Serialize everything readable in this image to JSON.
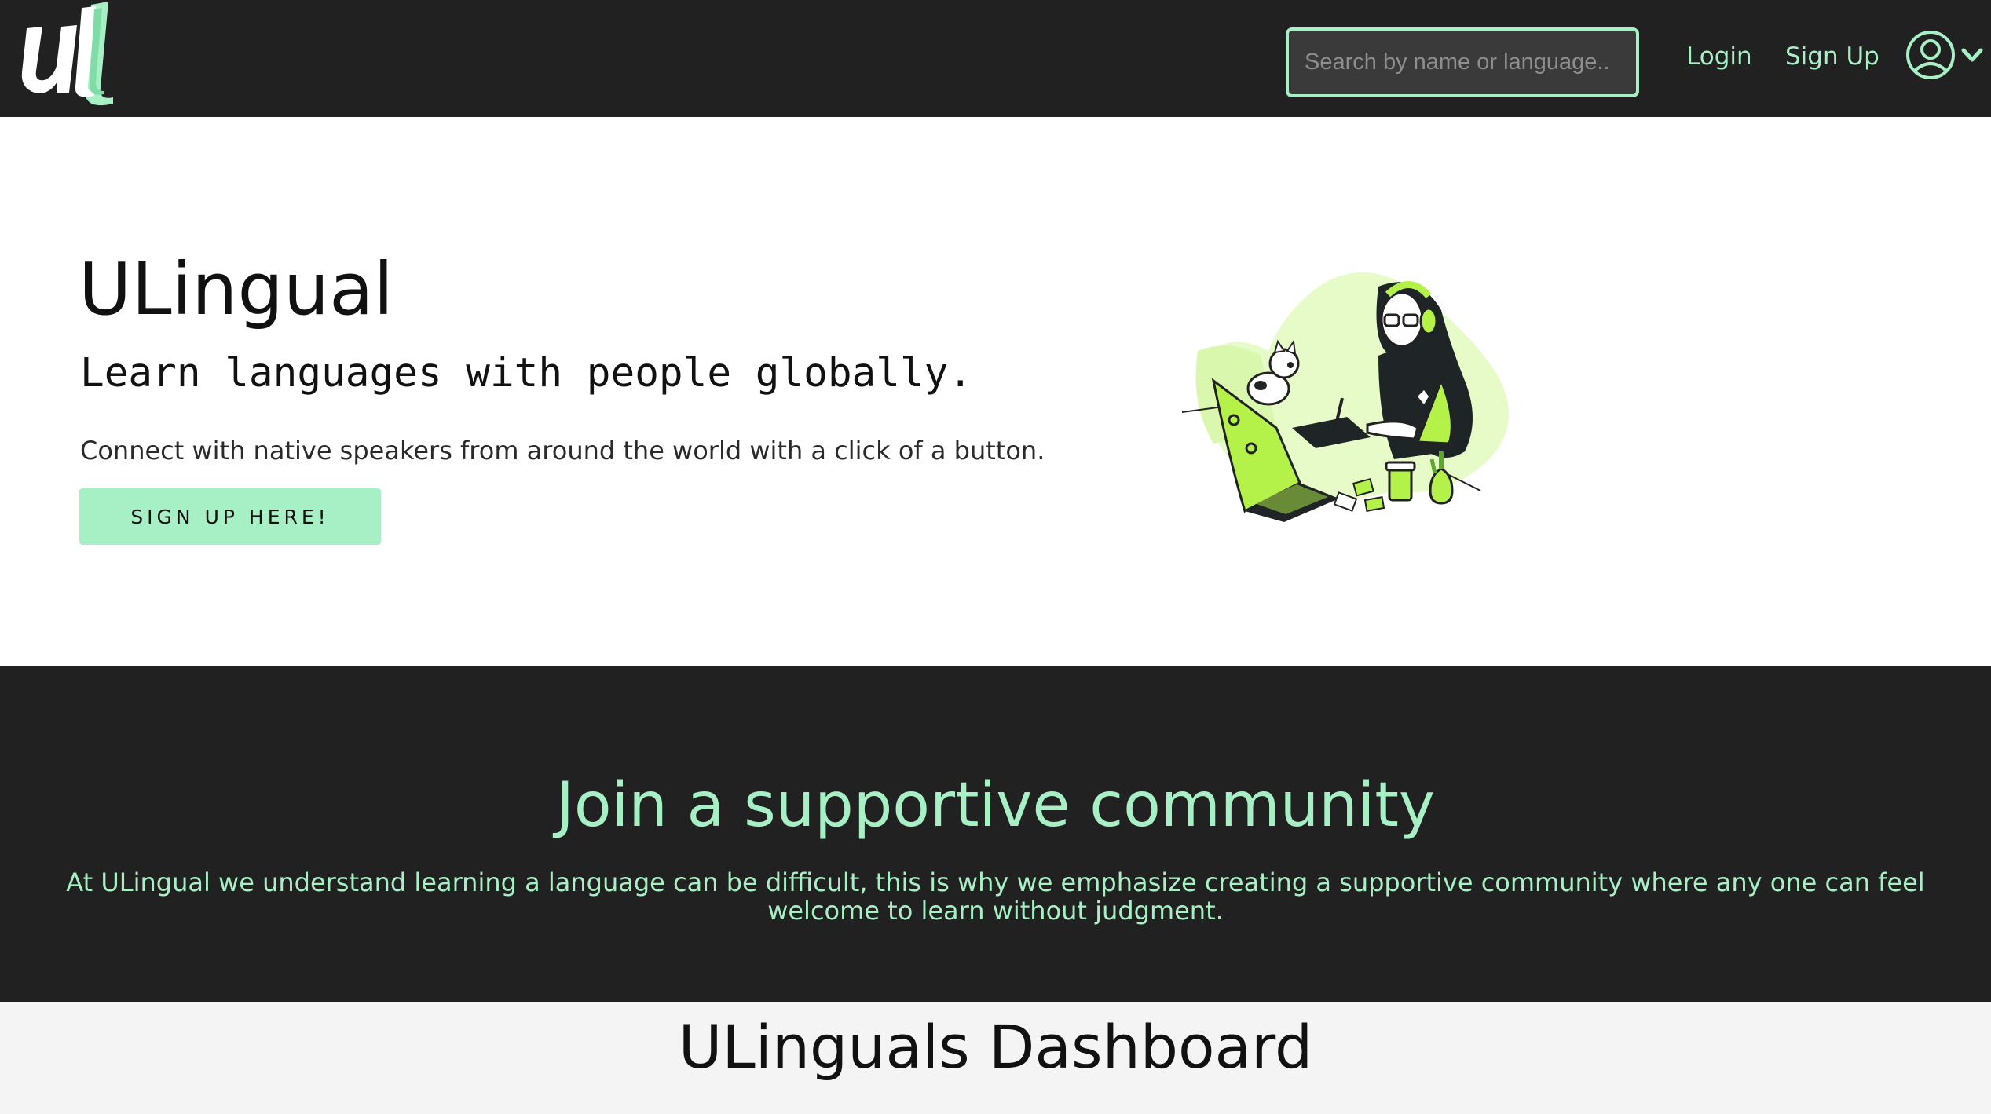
{
  "nav": {
    "logo_icon": "ulingual-logo",
    "search": {
      "placeholder": "Search by name or language..",
      "value": ""
    },
    "login_label": "Login",
    "signup_label": "Sign Up",
    "profile_icon": "user-circle-icon",
    "dropdown_icon": "chevron-down-icon"
  },
  "hero": {
    "title": "ULingual",
    "tagline": "Learn languages with people globally.",
    "description": "Connect with native speakers from around the world with a click of a button.",
    "cta_label": "SIGN UP HERE!",
    "illustration_icon": "person-at-laptop-illustration"
  },
  "community": {
    "title": "Join a supportive community",
    "text": "At ULingual we understand learning a language can be difficult, this is why we emphasize creating a supportive community where any one can feel welcome to learn without judgment."
  },
  "dashboard": {
    "title": "ULinguals Dashboard"
  },
  "colors": {
    "nav_bg": "#212121",
    "accent_mint": "#a7f0c5",
    "illustration_green": "#b4f24a",
    "dark_text": "#111111"
  }
}
